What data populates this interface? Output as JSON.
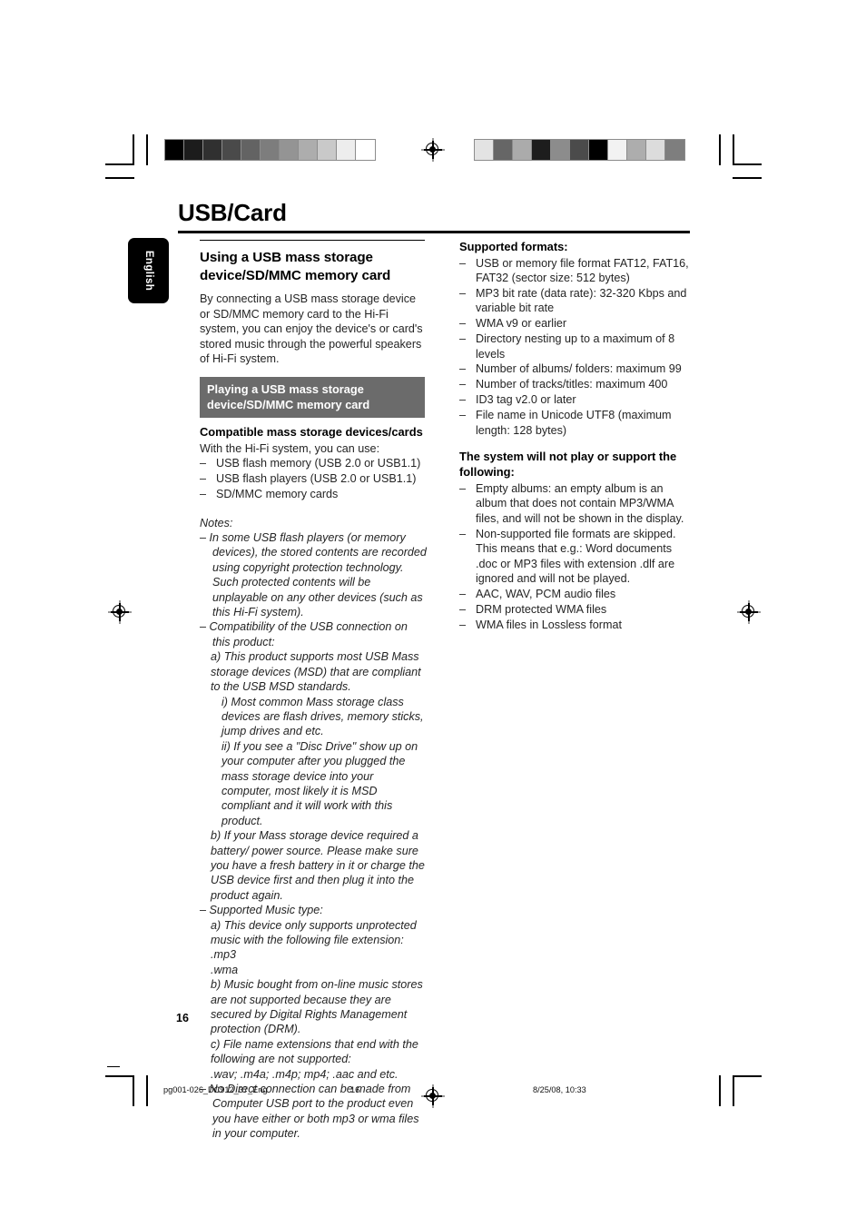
{
  "page": {
    "title": "USB/Card",
    "language_tab": "English",
    "page_number": "16"
  },
  "footer": {
    "filename": "pg001-026_DC912_37_Eng",
    "page": "16",
    "timestamp": "8/25/08, 10:33"
  },
  "left_column": {
    "heading": "Using a USB mass storage device/SD/MMC memory card",
    "intro": "By connecting a USB mass storage device or SD/MMC memory card to the Hi-Fi system, you can enjoy the device's or card's stored music through the powerful speakers of Hi-Fi system.",
    "band_title": "Playing a USB mass storage device/SD/MMC memory card",
    "compatible_heading": "Compatible mass storage devices/cards",
    "compatible_intro": "With the Hi-Fi system, you can use:",
    "compatible_items": [
      "USB flash memory (USB 2.0 or USB1.1)",
      "USB flash players (USB 2.0 or USB1.1)",
      "SD/MMC memory cards"
    ],
    "notes_label": "Notes:",
    "notes": [
      {
        "indent": 0,
        "hang": true,
        "text": "–  In some USB flash players (or memory devices), the stored contents are recorded using copyright protection technology. Such protected contents will be unplayable on any other devices (such as this Hi-Fi system)."
      },
      {
        "indent": 0,
        "hang": true,
        "text": "–  Compatibility of the USB connection on this product:"
      },
      {
        "indent": 1,
        "hang": false,
        "text": "a) This product supports most USB Mass storage devices (MSD) that are compliant to the USB MSD standards."
      },
      {
        "indent": 2,
        "hang": false,
        "text": "i) Most common Mass storage class devices are flash drives, memory sticks, jump drives and etc."
      },
      {
        "indent": 2,
        "hang": false,
        "text": "ii) If you see a \"Disc Drive\" show up on your computer after you plugged the mass storage device into your computer, most likely it is MSD compliant and it will work with this product."
      },
      {
        "indent": 1,
        "hang": false,
        "text": "b) If your Mass storage device required a battery/ power source. Please make sure you have a fresh battery in it or charge the USB device first and then plug it into the product again."
      },
      {
        "indent": 0,
        "hang": true,
        "text": "–  Supported Music type:"
      },
      {
        "indent": 1,
        "hang": false,
        "text": "a) This device only supports unprotected music with the following file extension:"
      },
      {
        "indent": 1,
        "hang": false,
        "text": ".mp3"
      },
      {
        "indent": 1,
        "hang": false,
        "text": ".wma"
      },
      {
        "indent": 1,
        "hang": false,
        "text": "b) Music bought from on-line music stores are not supported because they are secured by Digital Rights Management protection (DRM)."
      },
      {
        "indent": 1,
        "hang": false,
        "text": "c) File name extensions that end with the following are not supported:"
      },
      {
        "indent": 1,
        "hang": false,
        "text": ".wav; .m4a; .m4p; mp4; .aac and etc."
      },
      {
        "indent": 0,
        "hang": true,
        "text": "–  No Direct connection can be made from Computer USB port to the product even you have either or both mp3 or wma files in your computer."
      }
    ]
  },
  "right_column": {
    "supported_heading": "Supported formats:",
    "supported_items": [
      "USB or memory file format FAT12, FAT16, FAT32 (sector size: 512 bytes)",
      "MP3 bit rate (data rate): 32-320 Kbps and variable bit rate",
      "WMA v9 or earlier",
      "Directory nesting up to a maximum of 8 levels",
      "Number of albums/ folders: maximum 99",
      "Number of tracks/titles: maximum 400",
      "ID3 tag v2.0 or later",
      "File name in Unicode UTF8 (maximum length: 128 bytes)"
    ],
    "unsupported_heading": "The system will not play or support the following:",
    "unsupported_items": [
      "Empty albums: an empty album is an album that does not contain MP3/WMA files, and will not be shown in the display.",
      "Non-supported file formats are skipped. This means that e.g.: Word documents .doc or MP3 files with extension .dlf are ignored and will not be played.",
      "AAC, WAV, PCM audio files",
      "DRM protected WMA files",
      "WMA files in Lossless format"
    ]
  },
  "print_marks": {
    "dash": "–",
    "swatch_left": [
      "#000000",
      "#1c1c1c",
      "#303030",
      "#4a4a4a",
      "#636363",
      "#7d7d7d",
      "#949494",
      "#adadad",
      "#c9c9c9",
      "#ededed",
      "#ffffff"
    ],
    "swatch_right": [
      "#e3e3e3",
      "#666666",
      "#ababab",
      "#1d1d1d",
      "#8c8c8c",
      "#4b4b4b",
      "#000000",
      "#f2f2f2",
      "#adadad",
      "#dcdcdc",
      "#7e7e7e"
    ]
  }
}
